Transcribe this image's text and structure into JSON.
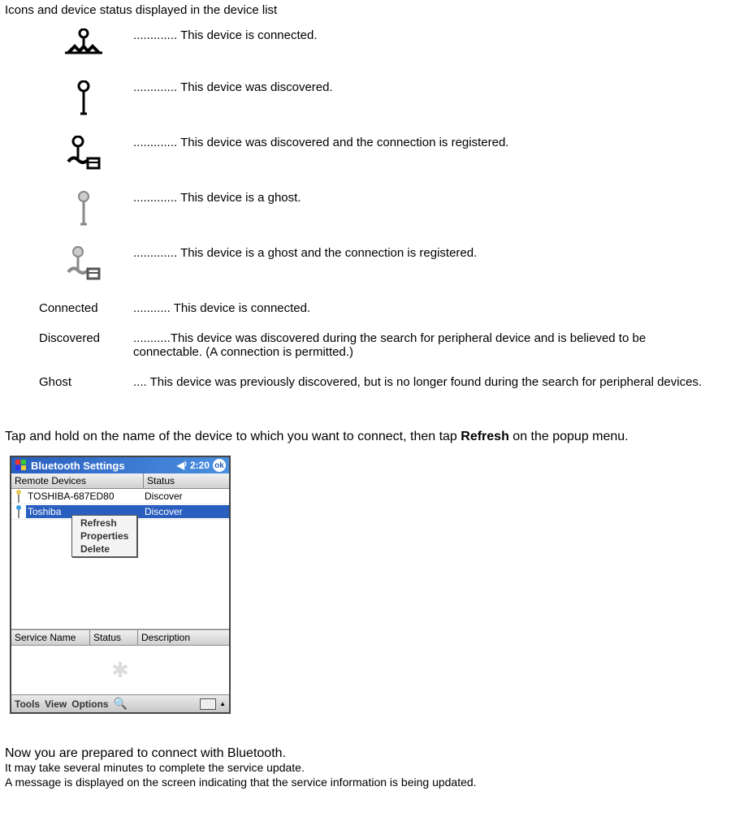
{
  "section_title": "Icons and device status displayed in the device list",
  "legend": [
    {
      "kind": "icon",
      "icon": "connected-icon",
      "desc": "............. This device is connected."
    },
    {
      "kind": "icon",
      "icon": "discovered-icon",
      "desc": "............. This device was discovered."
    },
    {
      "kind": "icon",
      "icon": "discovered-registered-icon",
      "desc": "............. This device was discovered and the connection is registered."
    },
    {
      "kind": "icon",
      "icon": "ghost-icon",
      "desc": "............. This device is a ghost."
    },
    {
      "kind": "icon",
      "icon": "ghost-registered-icon",
      "desc": "............. This device is a ghost and the connection is registered."
    },
    {
      "kind": "label",
      "label": "Connected",
      "desc": "........... This device is connected."
    },
    {
      "kind": "label",
      "label": "Discovered",
      "desc": "...........This device was discovered during the search for peripheral device and is believed to be connectable. (A connection is permitted.)"
    },
    {
      "kind": "label",
      "label": "Ghost",
      "desc": ".... This device was previously discovered, but is no longer found during the search for peripheral devices."
    }
  ],
  "instruction_pre": "Tap and hold on the name of the device to which you want to connect, then tap ",
  "instruction_bold": "Refresh",
  "instruction_post": " on the popup menu.",
  "screenshot": {
    "title": "Bluetooth Settings",
    "speaker_icon_name": "speaker-icon",
    "time": "2:20",
    "ok_label": "ok",
    "header_col1": "Remote Devices",
    "header_col2": "Status",
    "devices": [
      {
        "icon_color": "#e6c74f",
        "name": "TOSHIBA-687ED80",
        "status": "Discover",
        "selected": false
      },
      {
        "icon_color": "#3b9ee0",
        "name": "Toshiba",
        "status": "Discover",
        "selected": true
      }
    ],
    "popup_items": [
      "Refresh",
      "Properties",
      "Delete"
    ],
    "service_cols": [
      "Service Name",
      "Status",
      "Description"
    ],
    "menubar_items": [
      "Tools",
      "View",
      "Options"
    ]
  },
  "footer_line1": "Now you are prepared to connect with Bluetooth.",
  "footer_line2": "It may take several minutes to complete the service update.",
  "footer_line3": "A message is displayed on the screen indicating that the service information is being updated."
}
